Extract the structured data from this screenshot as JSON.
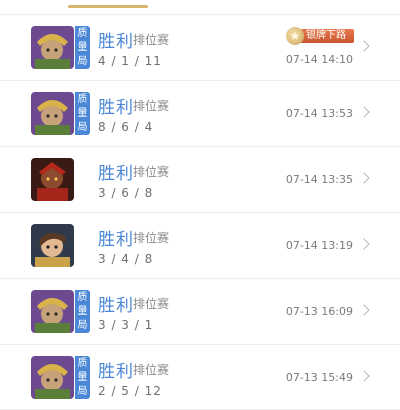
{
  "badge_text": [
    "质",
    "量",
    "局"
  ],
  "rank_badge": "银牌下路",
  "matches": [
    {
      "result": "胜利",
      "mode": "排位赛",
      "kda": "4 / 1 / 11",
      "time": "07-14 14:10",
      "hero": "hero-a"
    },
    {
      "result": "胜利",
      "mode": "排位赛",
      "kda": "8 / 6 / 4",
      "time": "07-14 13:53",
      "hero": "hero-a"
    },
    {
      "result": "胜利",
      "mode": "排位赛",
      "kda": "3 / 6 / 8",
      "time": "07-14 13:35",
      "hero": "hero-b"
    },
    {
      "result": "胜利",
      "mode": "排位赛",
      "kda": "3 / 4 / 8",
      "time": "07-14 13:19",
      "hero": "hero-c"
    },
    {
      "result": "胜利",
      "mode": "排位赛",
      "kda": "3 / 3 / 1",
      "time": "07-13 16:09",
      "hero": "hero-a"
    },
    {
      "result": "胜利",
      "mode": "排位赛",
      "kda": "2 / 5 / 12",
      "time": "07-13 15:49",
      "hero": "hero-a"
    }
  ],
  "colors": {
    "accent": "#4a87d6",
    "tab_indicator": "#d8b46c"
  }
}
